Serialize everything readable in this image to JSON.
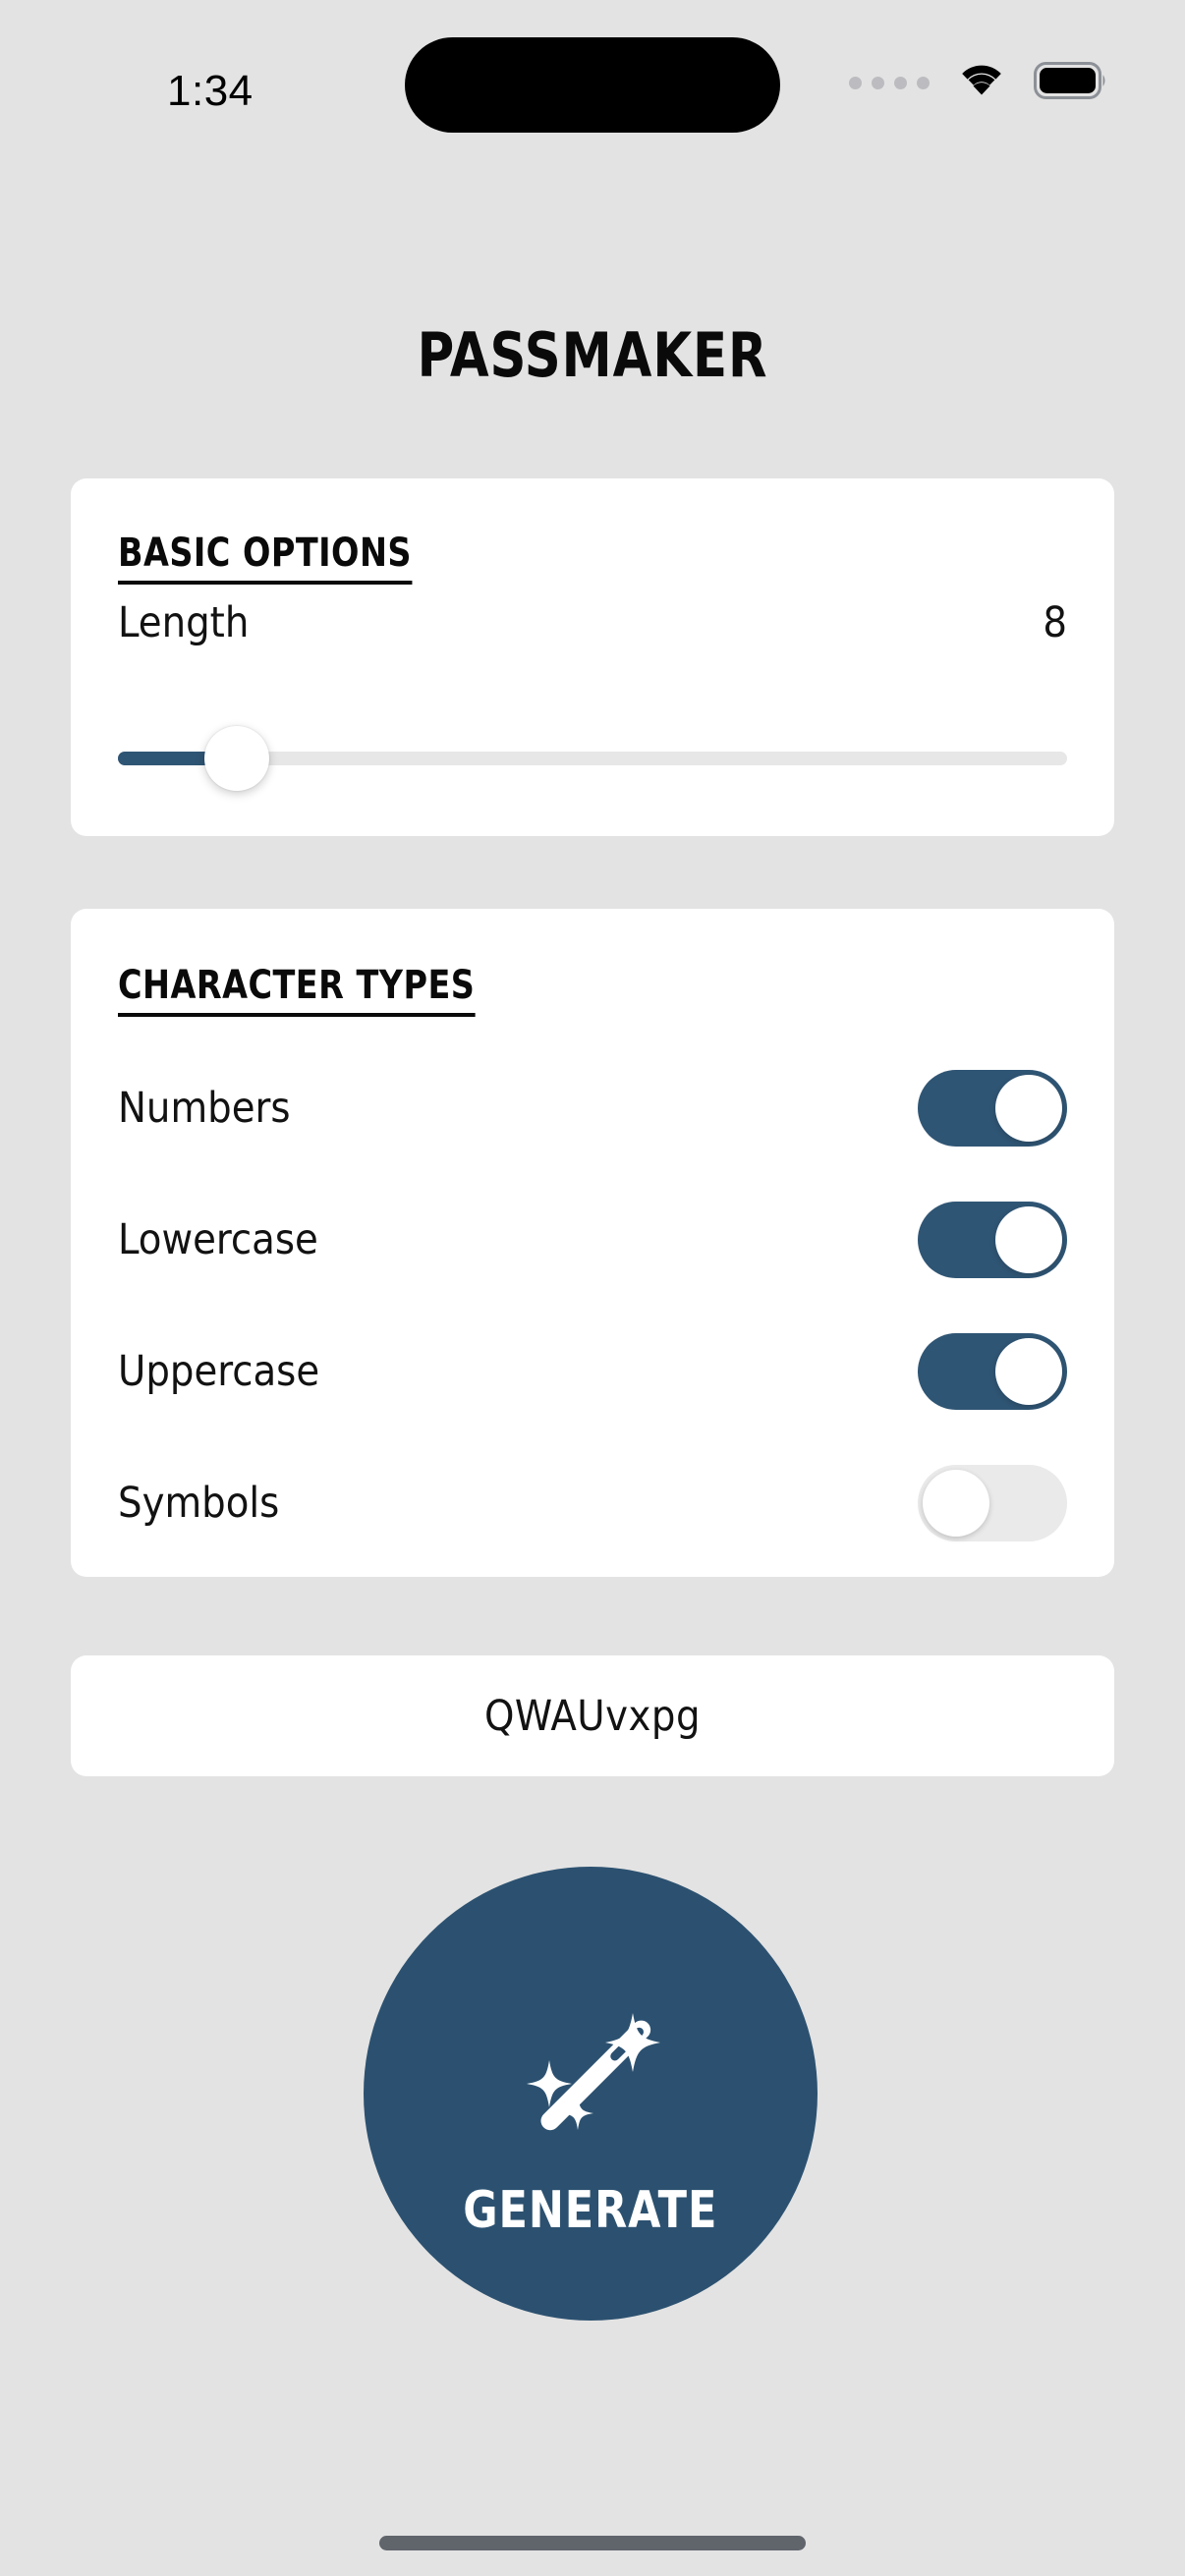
{
  "status_bar": {
    "time": "1:34",
    "signal_icon": "signal-dots-icon",
    "wifi_icon": "wifi-icon",
    "battery_icon": "battery-full-icon",
    "dynamic_island": "dynamic-island"
  },
  "app": {
    "title": "PASSMAKER",
    "background_color": "#e3e3e3",
    "accent_color": "#2f5574",
    "card_color": "#ffffff"
  },
  "basic_options": {
    "heading": "BASIC OPTIONS",
    "length_label": "Length",
    "length_value": "8",
    "slider": {
      "value": 8,
      "min": 4,
      "max": 64,
      "fill_percent": 12
    }
  },
  "character_types": {
    "heading": "CHARACTER TYPES",
    "items": [
      {
        "label": "Numbers",
        "enabled": true,
        "state": "on"
      },
      {
        "label": "Lowercase",
        "enabled": true,
        "state": "on"
      },
      {
        "label": "Uppercase",
        "enabled": true,
        "state": "on"
      },
      {
        "label": "Symbols",
        "enabled": false,
        "state": "off"
      }
    ]
  },
  "output": {
    "password": "QWAUvxpg"
  },
  "generate": {
    "label": "GENERATE",
    "icon": "magic-wand-icon",
    "color": "#2c5170"
  },
  "home_indicator": "home-indicator"
}
